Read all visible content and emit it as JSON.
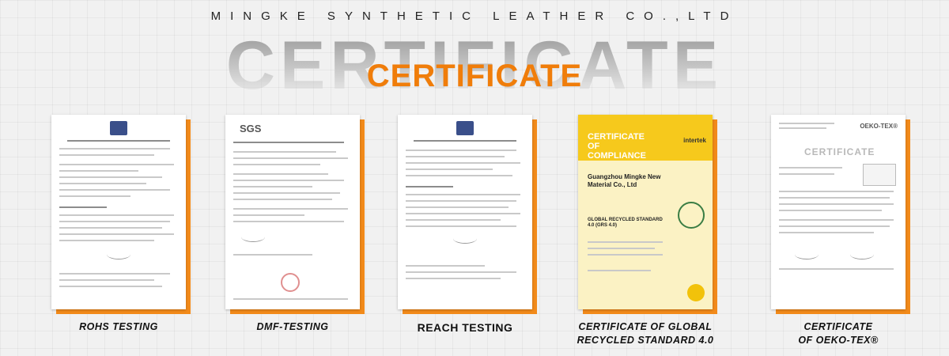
{
  "header": {
    "company": "MINGKE SYNTHETIC LEATHER CO.,LTD",
    "watermark": "CERTIFICATE",
    "title": "CERTIFICATE"
  },
  "colors": {
    "accent": "#f07d0a",
    "frame": "#f28a1a",
    "grs_yellow": "#f6c91c"
  },
  "cards": [
    {
      "label": "ROHS TESTING"
    },
    {
      "label": "DMF-TESTING",
      "doc_logo": "SGS"
    },
    {
      "label": "REACH TESTING"
    },
    {
      "label_line1": "CERTIFICATE OF GLOBAL",
      "label_line2": "RECYCLED STANDARD 4.0",
      "doc_title": "CERTIFICATE OF COMPLIANCE",
      "doc_brand": "intertek",
      "doc_company": "Guangzhou Mingke New Material Co., Ltd",
      "doc_standard": "GLOBAL RECYCLED STANDARD 4.0 (GRS 4.0)"
    },
    {
      "label_line1": "CERTIFICATE",
      "label_line2": "OF OEKO-TEX®",
      "doc_brand": "OEKO-TEX®",
      "doc_word": "CERTIFICATE"
    }
  ]
}
